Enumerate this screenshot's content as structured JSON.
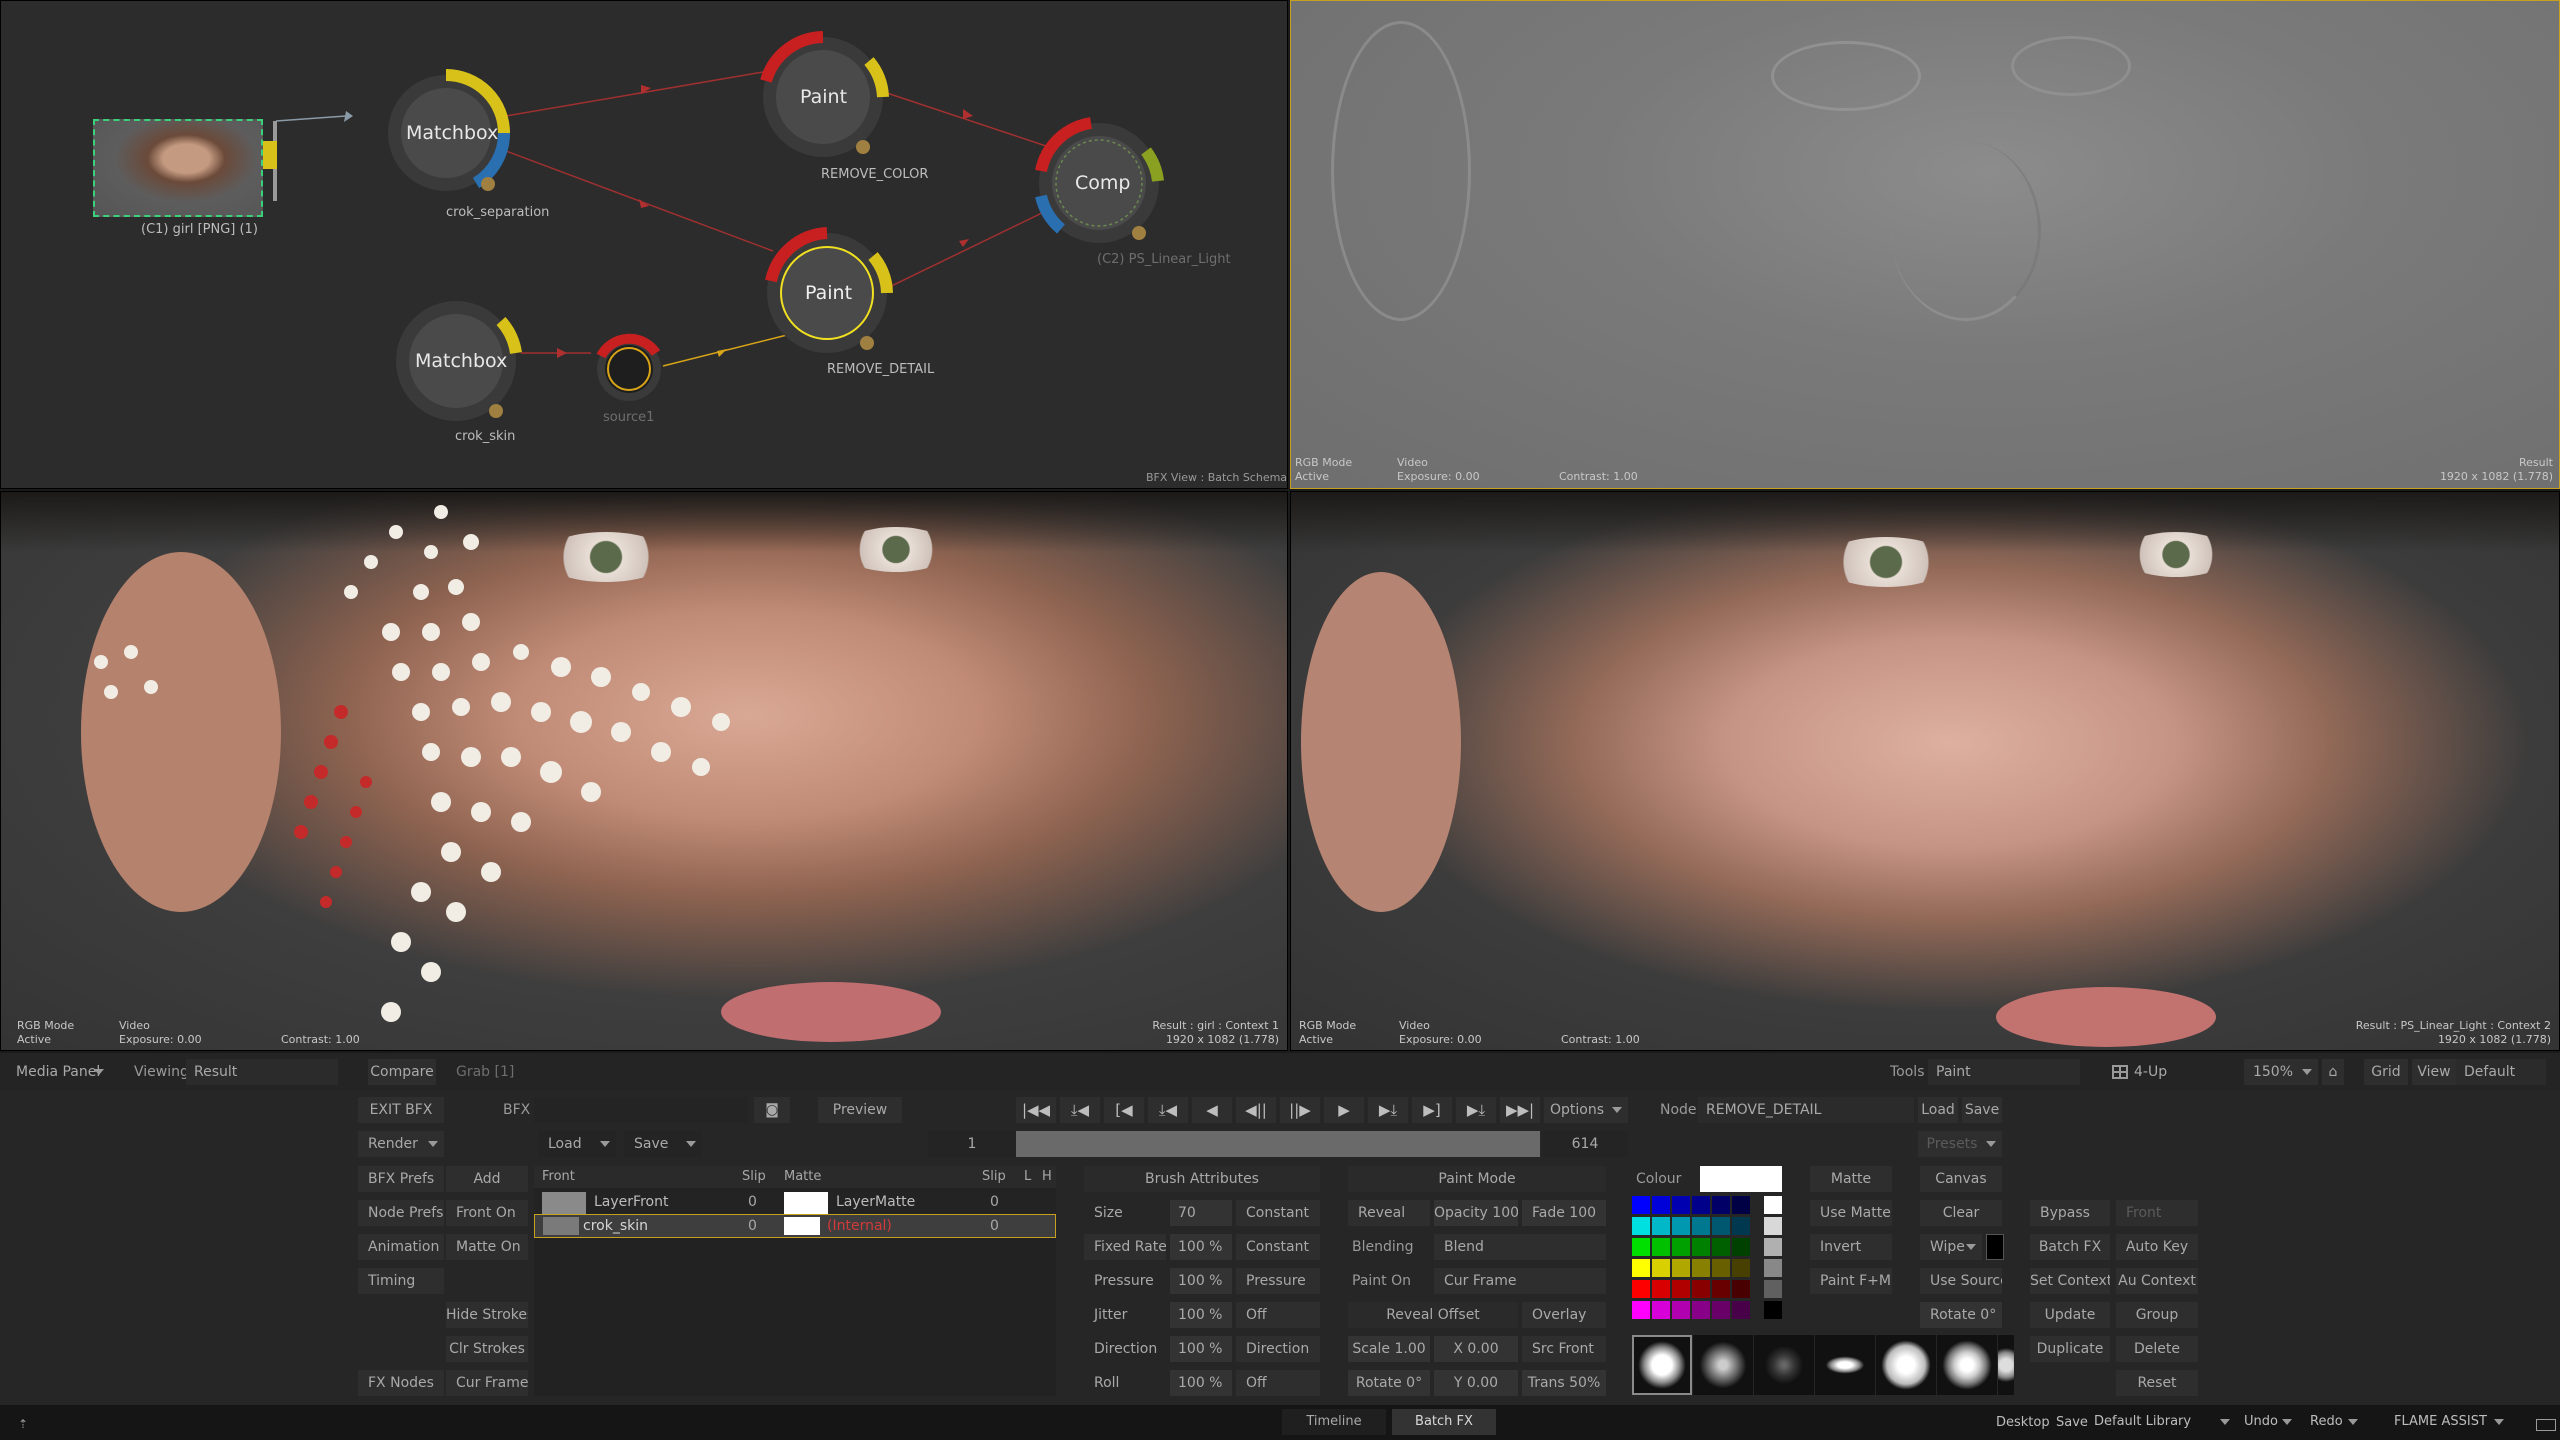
{
  "schematic": {
    "nodes": {
      "clip_label": "(C1) girl [PNG] (1)",
      "matchbox1": "Matchbox",
      "matchbox1_sub": "crok_separation",
      "paint1": "Paint",
      "paint1_sub": "REMOVE_COLOR",
      "comp": "Comp",
      "comp_sub": "(C2) PS_Linear_Light",
      "matchbox2": "Matchbox",
      "matchbox2_sub": "crok_skin",
      "source": "source1",
      "paint2": "Paint",
      "paint2_sub": "REMOVE_DETAIL"
    },
    "view_label": "BFX View : Batch Schematic"
  },
  "viewers": {
    "top_right": {
      "mode": "RGB Mode",
      "mode2": "Active",
      "video": "Video",
      "exposure": "Exposure: 0.00",
      "contrast": "Contrast: 1.00",
      "result": "Result",
      "res": "1920 x 1082 (1.778)"
    },
    "bottom_left": {
      "mode": "RGB Mode",
      "mode2": "Active",
      "video": "Video",
      "exposure": "Exposure: 0.00",
      "contrast": "Contrast: 1.00",
      "result": "Result : girl : Context 1",
      "res": "1920 x 1082 (1.778)"
    },
    "bottom_right": {
      "mode": "RGB Mode",
      "mode2": "Active",
      "video": "Video",
      "exposure": "Exposure: 0.00",
      "contrast": "Contrast: 1.00",
      "result": "Result : PS_Linear_Light : Context 2",
      "res": "1920 x 1082 (1.778)"
    }
  },
  "viewbar": {
    "media_panel": "Media Panel",
    "viewing_label": "Viewing",
    "viewing_value": "Result",
    "compare": "Compare",
    "grab": "Grab [1]",
    "tools_label": "Tools",
    "tools_value": "Paint",
    "layout": "4-Up",
    "zoom": "150%",
    "grid": "Grid",
    "view": "View",
    "default": "Default"
  },
  "transport": {
    "exit_bfx": "EXIT BFX",
    "bfx_label": "BFX",
    "preview": "Preview",
    "render": "Render",
    "load": "Load",
    "save": "Save",
    "frame_start": "1",
    "frame_end": "614",
    "options": "Options",
    "node_label": "Node",
    "node_value": "REMOVE_DETAIL",
    "node_load": "Load",
    "node_save": "Save",
    "presets": "Presets",
    "buttons": [
      "|◀◀",
      "⤓◀",
      "[◀",
      "⤓◀",
      "◀",
      "◀||",
      "||▶",
      "▶",
      "▶⤓",
      "▶]",
      "▶⤓",
      "▶▶|"
    ]
  },
  "left_buttons": {
    "bfx_prefs": "BFX Prefs",
    "add": "Add",
    "node_prefs": "Node Prefs",
    "front_on": "Front On",
    "animation": "Animation",
    "matte_on": "Matte On",
    "timing": "Timing",
    "hide_strokes": "Hide Strokes",
    "clr_strokes": "Clr Strokes",
    "fx_nodes": "FX Nodes",
    "cur_frame": "Cur Frame"
  },
  "layers": {
    "headers": {
      "front": "Front",
      "slip": "Slip",
      "matte": "Matte",
      "slip2": "Slip",
      "l": "L",
      "h": "H"
    },
    "rows": [
      {
        "front": "LayerFront",
        "slip": "0",
        "matte": "LayerMatte",
        "slip2": "0"
      },
      {
        "front": "crok_skin",
        "slip": "0",
        "matte": "(Internal)",
        "slip2": "0"
      }
    ]
  },
  "brush_attributes": {
    "title": "Brush Attributes",
    "rows": [
      {
        "label": "Size",
        "value": "70",
        "mode": "Constant"
      },
      {
        "label": "Fixed Rate",
        "value": "100 %",
        "mode": "Constant"
      },
      {
        "label": "Pressure",
        "value": "100 %",
        "mode": "Pressure"
      },
      {
        "label": "Jitter",
        "value": "100 %",
        "mode": "Off"
      },
      {
        "label": "Direction",
        "value": "100 %",
        "mode": "Direction"
      },
      {
        "label": "Roll",
        "value": "100 %",
        "mode": "Off"
      }
    ]
  },
  "paint_mode": {
    "title": "Paint Mode",
    "reveal": "Reveal",
    "opacity": "Opacity 100",
    "fade": "Fade 100",
    "blending_label": "Blending",
    "blend": "Blend",
    "paint_on_label": "Paint On",
    "cur_frame": "Cur Frame",
    "reveal_offset": "Reveal Offset",
    "overlay": "Overlay",
    "scale": "Scale 1.00",
    "x": "X 0.00",
    "src_front": "Src Front",
    "rotate": "Rotate 0°",
    "y": "Y 0.00",
    "trans": "Trans 50%"
  },
  "colour": {
    "label": "Colour",
    "current": "#ffffff"
  },
  "matte_col": {
    "matte": "Matte",
    "use_matte": "Use Matte",
    "invert": "Invert",
    "paint_fm": "Paint F+M"
  },
  "canvas_col": {
    "canvas": "Canvas",
    "clear": "Clear",
    "wipe": "Wipe",
    "use_source": "Use Source",
    "rotate": "Rotate 0°"
  },
  "right_buttons": {
    "bypass": "Bypass",
    "front": "Front",
    "batch_fx": "Batch FX",
    "auto_key": "Auto Key",
    "set_context": "Set Context",
    "au_context": "Au Context",
    "update": "Update",
    "group": "Group",
    "duplicate": "Duplicate",
    "delete": "Delete",
    "reset": "Reset"
  },
  "bottom_bar": {
    "tab_timeline": "Timeline",
    "tab_batchfx": "Batch FX",
    "desktop": "Desktop",
    "save": "Save",
    "library": "Default Library",
    "undo": "Undo",
    "redo": "Redo",
    "flame_assist": "FLAME ASSIST"
  }
}
